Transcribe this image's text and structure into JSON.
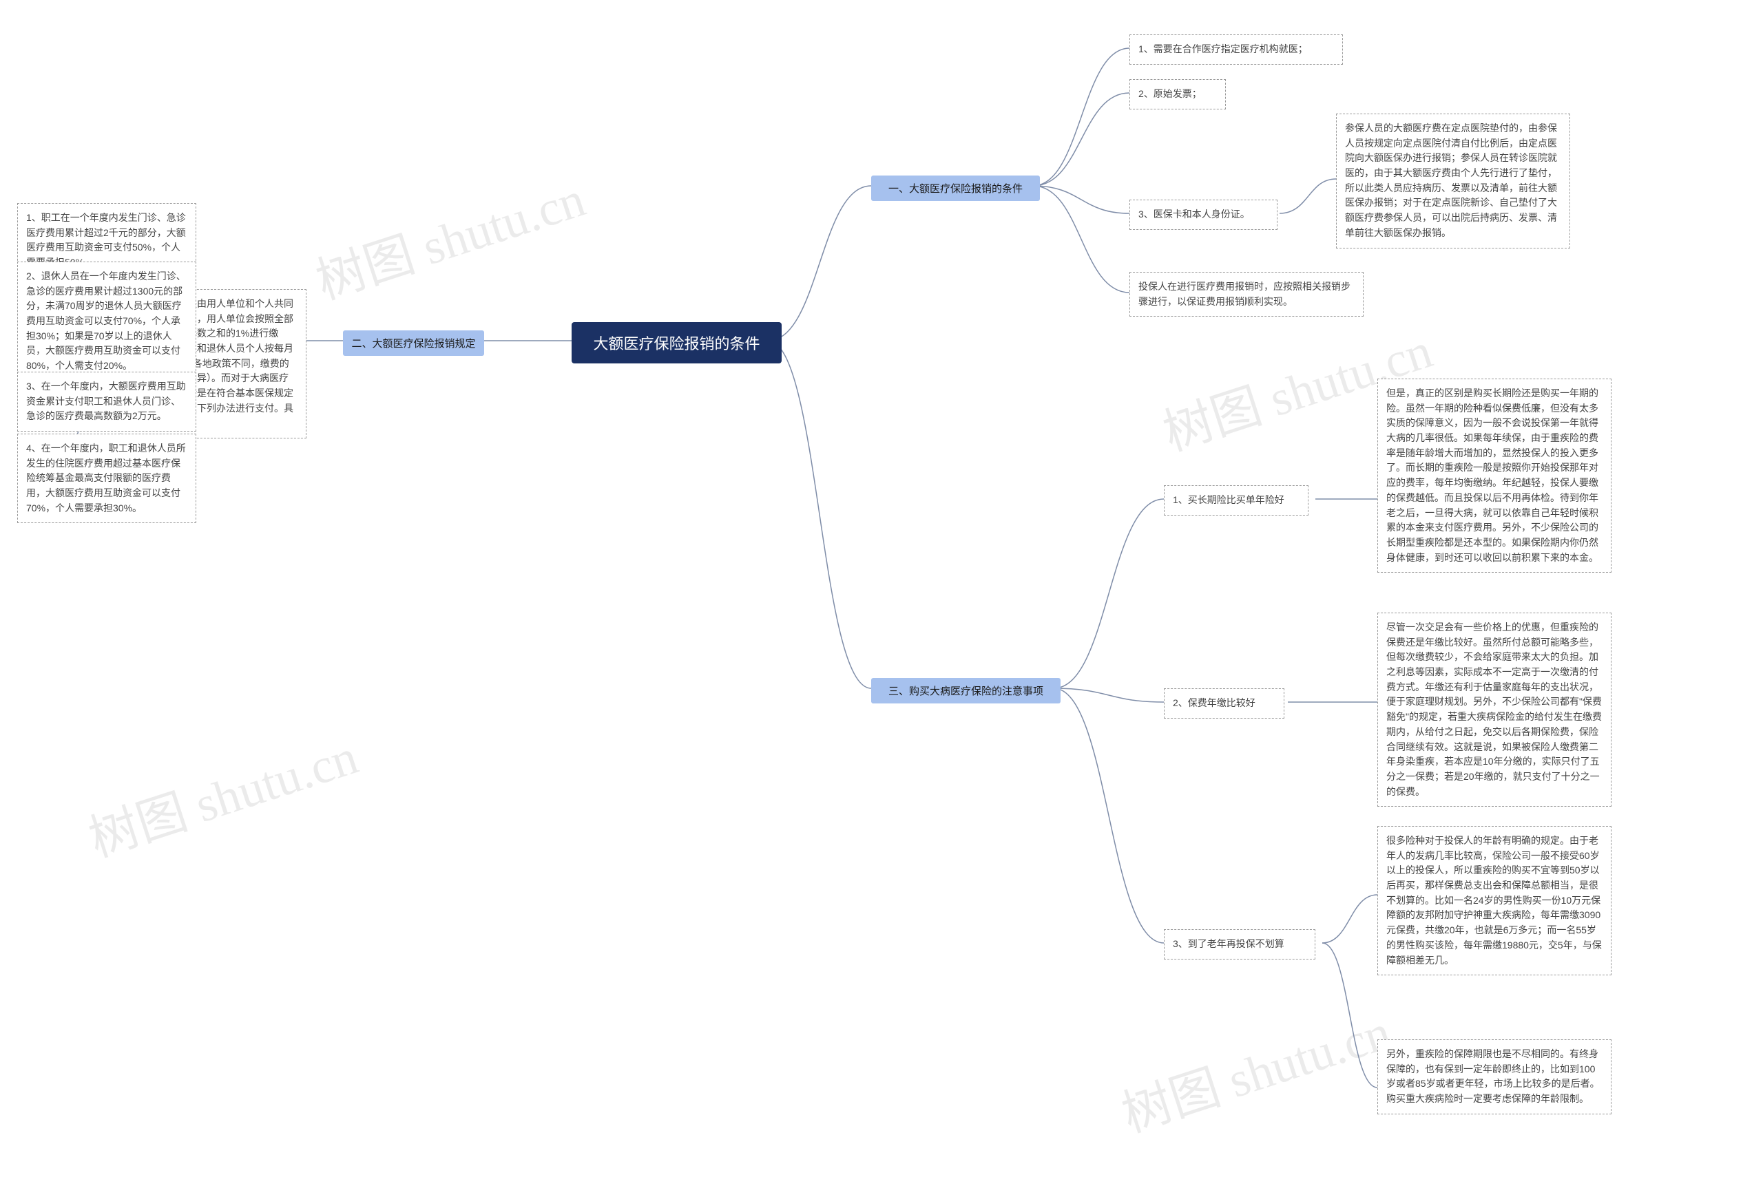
{
  "watermark": "树图 shutu.cn",
  "root": {
    "title": "大额医疗保险报销的条件"
  },
  "branches": {
    "b1": {
      "label": "一、大额医疗保险报销的条件"
    },
    "b2": {
      "label": "二、大额医疗保险报销规定"
    },
    "b3": {
      "label": "三、购买大病医疗保险的注意事项"
    }
  },
  "leaves": {
    "b1_l1": {
      "text": "1、需要在合作医疗指定医疗机构就医；"
    },
    "b1_l2": {
      "text": "2、原始发票；"
    },
    "b1_l3": {
      "text": "3、医保卡和本人身份证。"
    },
    "b1_l3_sub": {
      "text": "参保人员的大额医疗费在定点医院垫付的，由参保人员按规定向定点医院付清自付比例后，由定点医院向大额医保办进行报销；参保人员在转诊医院就医的，由于其大额医疗费由个人先行进行了垫付，所以此类人员应持病历、发票以及清单，前往大额医保办报销；对于在定点医院新诊、自己垫付了大额医疗费参保人员，可以出院后持病历、发票、清单前往大额医保办报销。"
    },
    "b1_l4": {
      "text": "投保人在进行医疗费用报销时，应按照相关报销步骤进行，以保证费用报销顺利实现。"
    },
    "b2_intro": {
      "text": "大额医疗保险是由用人单位和个人共同进行缴纳。其中，用人单位会按照全部职工缴费工资基数之和的1%进行缴纳，其中，职工和退休人员个人按每月3元缴纳（根据各地政策不同，缴费的金额也会存在差异）。而对于大病医疗保险的报销一般是在符合基本医保规定的前提下可按照下列办法进行支付。具体如下："
    },
    "b2_l1": {
      "text": "1、职工在一个年度内发生门诊、急诊医疗费用累计超过2千元的部分，大额医疗费用互助资金可支付50%，个人需要承担50%。"
    },
    "b2_l2": {
      "text": "2、退休人员在一个年度内发生门诊、急诊的医疗费用累计超过1300元的部分，未满70周岁的退休人员大额医疗费用互助资金可以支付70%，个人承担30%；如果是70岁以上的退休人员，大额医疗费用互助资金可以支付80%，个人需支付20%。"
    },
    "b2_l3": {
      "text": "3、在一个年度内，大额医疗费用互助资金累计支付职工和退休人员门诊、急诊的医疗费最高数额为2万元。"
    },
    "b2_l4": {
      "text": "4、在一个年度内，职工和退休人员所发生的住院医疗费用超过基本医疗保险统筹基金最高支付限额的医疗费用，大额医疗费用互助资金可以支付70%，个人需要承担30%。"
    },
    "b3_l1": {
      "text": "1、买长期险比买单年险好"
    },
    "b3_l1_sub": {
      "text": "但是，真正的区别是购买长期险还是购买一年期的险。虽然一年期的险种看似保费低廉，但没有太多实质的保障意义，因为一般不会说投保第一年就得大病的几率很低。如果每年续保，由于重疾险的费率是随年龄增大而增加的，显然投保人的投入更多了。而长期的重疾险一般是按照你开始投保那年对应的费率，每年均衡缴纳。年纪越轻，投保人要缴的保费越低。而且投保以后不用再体检。待到你年老之后，一旦得大病，就可以依靠自己年轻时候积累的本金来支付医疗费用。另外，不少保险公司的长期型重疾险都是还本型的。如果保险期内你仍然身体健康，到时还可以收回以前积累下来的本金。"
    },
    "b3_l2": {
      "text": "2、保费年缴比较好"
    },
    "b3_l2_sub": {
      "text": "尽管一次交足会有一些价格上的优惠，但重疾险的保费还是年缴比较好。虽然所付总额可能略多些，但每次缴费较少，不会给家庭带来太大的负担。加之利息等因素，实际成本不一定高于一次缴清的付费方式。年缴还有利于估量家庭每年的支出状况，便于家庭理财规划。另外，不少保险公司都有\"保费豁免\"的规定，若重大疾病保险金的给付发生在缴费期内，从给付之日起，免交以后各期保险费，保险合同继续有效。这就是说，如果被保险人缴费第二年身染重疾，若本应是10年分缴的，实际只付了五分之一保费；若是20年缴的，就只支付了十分之一的保费。"
    },
    "b3_l3": {
      "text": "3、到了老年再投保不划算"
    },
    "b3_l3_sub1": {
      "text": "很多险种对于投保人的年龄有明确的规定。由于老年人的发病几率比较高，保险公司一般不接受60岁以上的投保人，所以重疾险的购买不宜等到50岁以后再买，那样保费总支出会和保障总额相当，是很不划算的。比如一名24岁的男性购买一份10万元保障额的友邦附加守护神重大疾病险，每年需缴3090元保费，共缴20年，也就是6万多元；而一名55岁的男性购买该险，每年需缴19880元，交5年，与保障额相差无几。"
    },
    "b3_l3_sub2": {
      "text": "另外，重疾险的保障期限也是不尽相同的。有终身保障的，也有保到一定年龄即终止的，比如到100岁或者85岁或者更年轻，市场上比较多的是后者。购买重大疾病险时一定要考虑保障的年龄限制。"
    }
  }
}
